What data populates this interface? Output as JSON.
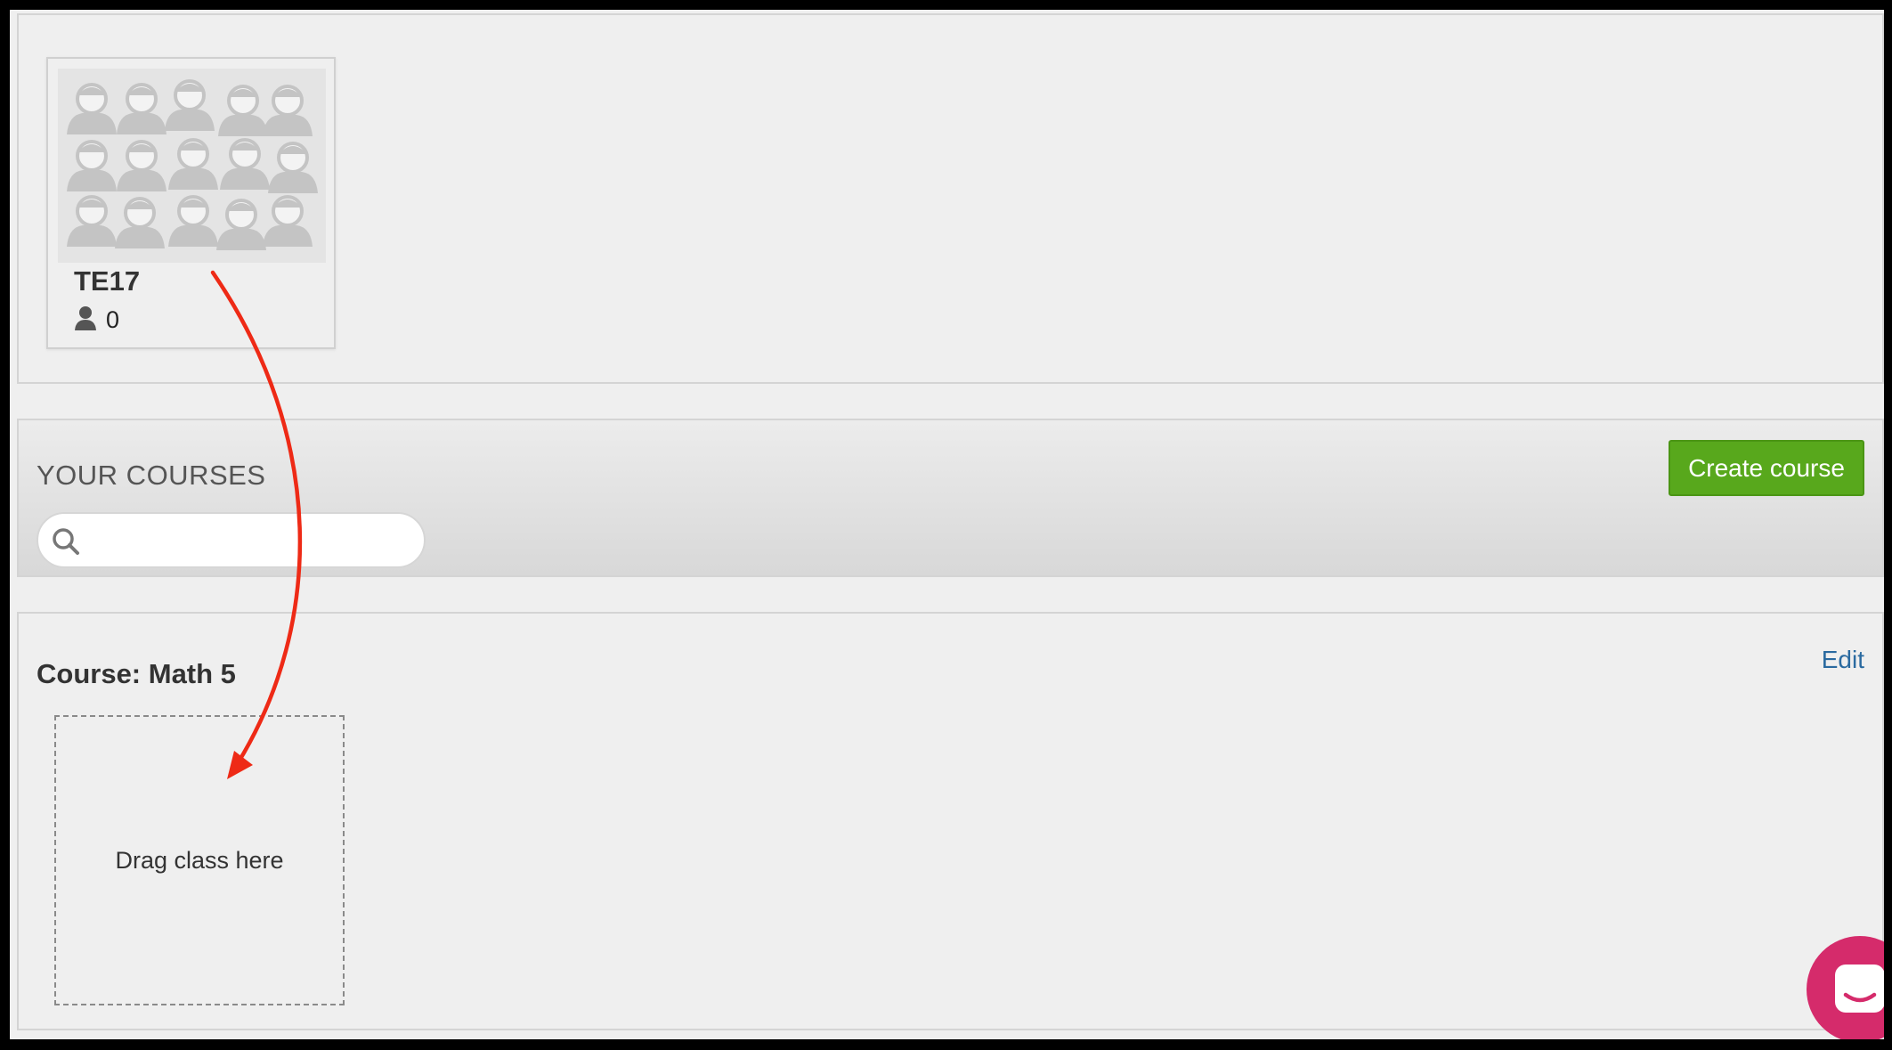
{
  "class_card": {
    "name": "TE17",
    "student_count": "0",
    "thumbnail_icon": "students-group-icon",
    "student_icon": "person-icon"
  },
  "courses": {
    "title": "YOUR COURSES",
    "search_placeholder": "",
    "search_value": "",
    "create_label": "Create course"
  },
  "course": {
    "title": "Course: Math 5",
    "edit_label": "Edit",
    "drop_label": "Drag class here"
  },
  "annotation": {
    "arrow_color": "#ee2a16"
  },
  "colors": {
    "accent_green": "#58a81c",
    "link_blue": "#2a6aa0",
    "chat_pink": "#d52b6b"
  },
  "chat": {
    "icon": "chat-bubble-icon"
  }
}
